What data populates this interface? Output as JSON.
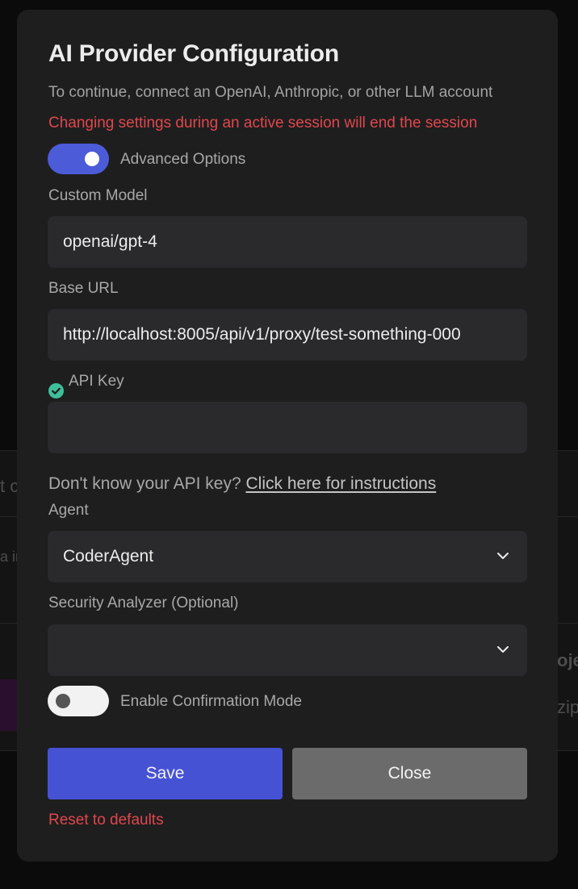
{
  "modal": {
    "title": "AI Provider Configuration",
    "subtitle": "To continue, connect an OpenAI, Anthropic, or other LLM account",
    "warning": "Changing settings during an active session will end the session"
  },
  "advanced_options": {
    "label": "Advanced Options",
    "enabled": true
  },
  "custom_model": {
    "label": "Custom Model",
    "value": "openai/gpt-4"
  },
  "base_url": {
    "label": "Base URL",
    "value": "http://localhost:8005/api/v1/proxy/test-something-000"
  },
  "api_key": {
    "label": "API Key",
    "value": "",
    "status_icon": "check-circle-icon",
    "help_text": "Don't know your API key?",
    "help_link": "Click here for instructions"
  },
  "agent": {
    "label": "Agent",
    "value": "CoderAgent"
  },
  "security_analyzer": {
    "label": "Security Analyzer (Optional)",
    "value": ""
  },
  "confirmation_mode": {
    "label": "Enable Confirmation Mode",
    "enabled": false
  },
  "buttons": {
    "save": "Save",
    "close": "Close"
  },
  "reset_label": "Reset to defaults",
  "colors": {
    "accent": "#4652d4",
    "toggle_on": "#4c5bd8",
    "warning": "#e0474c",
    "success": "#3fbf9a",
    "close_button": "#6b6b6b"
  },
  "background_fragments": [
    "t c",
    "a in",
    "oje",
    "zip"
  ]
}
